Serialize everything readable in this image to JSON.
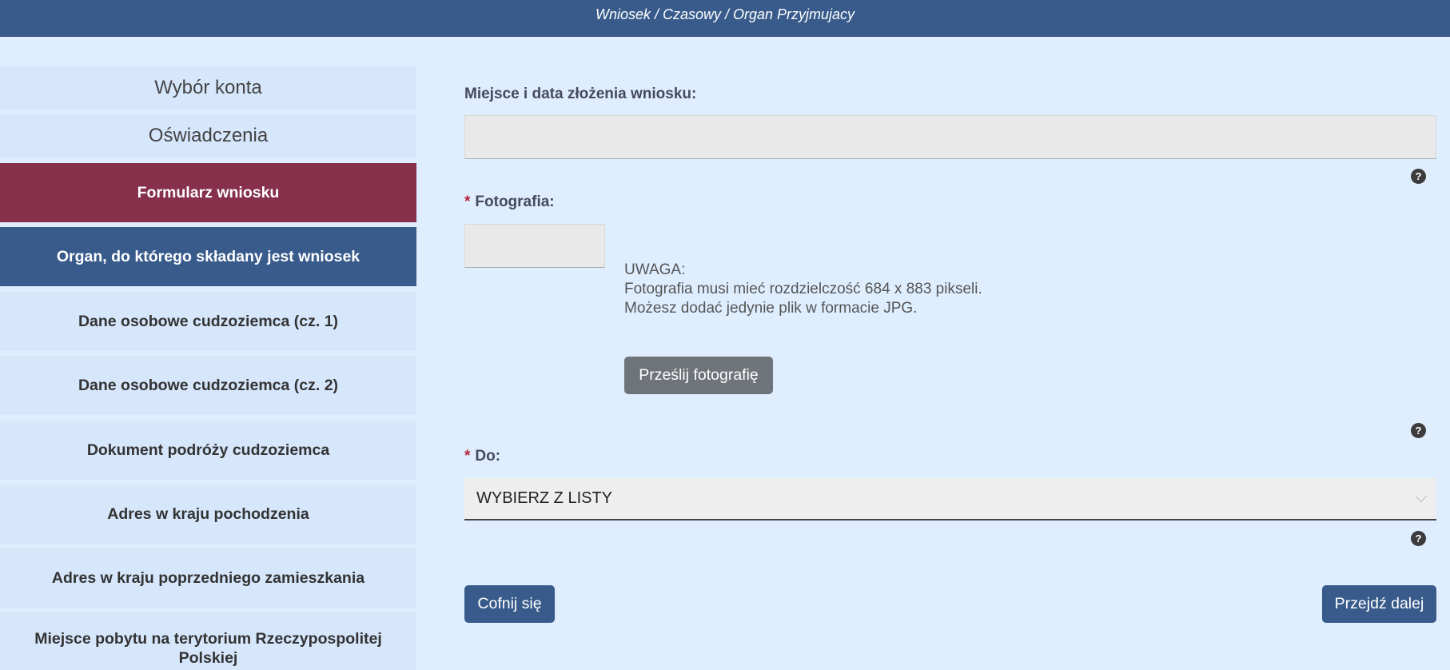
{
  "header": {
    "breadcrumb": "Wniosek / Czasowy / Organ Przyjmujacy"
  },
  "sidebar": {
    "items": [
      {
        "label": "Wybór konta"
      },
      {
        "label": "Oświadczenia"
      },
      {
        "label": "Formularz wniosku"
      },
      {
        "label": "Organ, do którego składany jest wniosek"
      },
      {
        "label": "Dane osobowe cudzoziemca (cz. 1)"
      },
      {
        "label": "Dane osobowe cudzoziemca (cz. 2)"
      },
      {
        "label": "Dokument podróży cudzoziemca"
      },
      {
        "label": "Adres w kraju pochodzenia"
      },
      {
        "label": "Adres w kraju poprzedniego zamieszkania"
      },
      {
        "label": "Miejsce pobytu na terytorium Rzeczypospolitej Polskiej"
      }
    ]
  },
  "form": {
    "place_date": {
      "label": "Miejsce i data złożenia wniosku:",
      "value": ""
    },
    "photo": {
      "required_mark": "*",
      "label": "Fotografia:",
      "note_title": "UWAGA:",
      "note_line1": "Fotografia musi mieć rozdzielczość 684 x 883 pikseli.",
      "note_line2": "Możesz dodać jedynie plik w formacie JPG.",
      "upload_label": "Prześlij fotografię"
    },
    "to": {
      "required_mark": "*",
      "label": "Do:",
      "selected": "WYBIERZ Z LISTY"
    },
    "help_icon_text": "?",
    "back_label": "Cofnij się",
    "next_label": "Przejdź dalej"
  },
  "colors": {
    "header": "#385b8b",
    "active_red": "#86304c",
    "active_blue": "#385b8b",
    "background": "#dfeeff",
    "sidebar_item": "#d6e6fb"
  }
}
